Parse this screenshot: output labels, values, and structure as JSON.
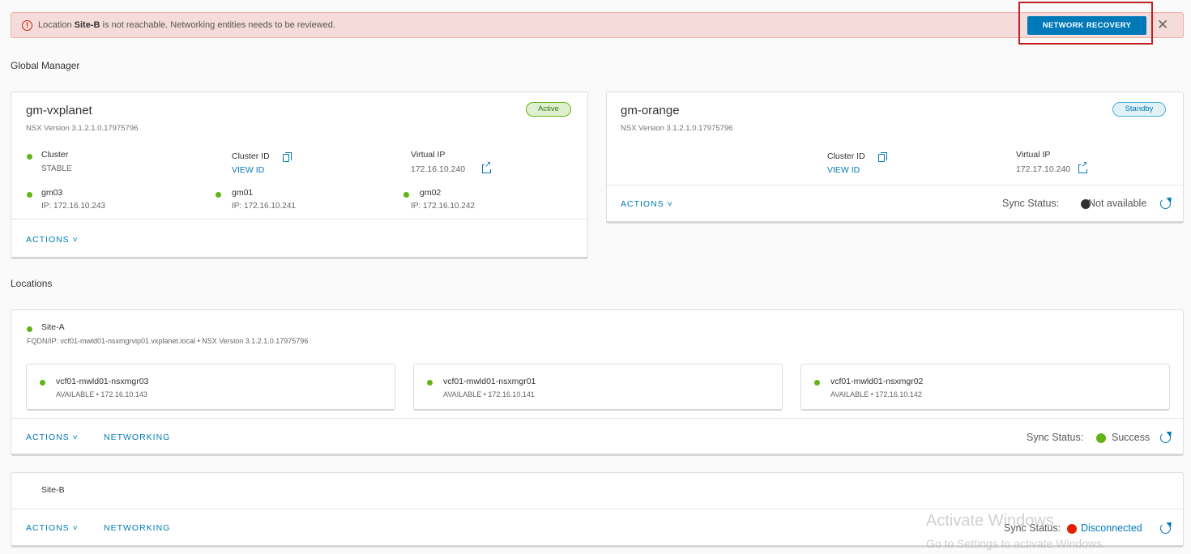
{
  "alert": {
    "prefix": "Location ",
    "site": "Site-B",
    "suffix": " is not reachable. Networking entities needs to be reviewed.",
    "button": "NETWORK RECOVERY",
    "close": "✕"
  },
  "global_manager": {
    "title": "Global Manager",
    "primary": {
      "name": "gm-vxplanet",
      "status": "Active",
      "version": "NSX Version  3.1.2.1.0.17975796",
      "cluster_label": "Cluster",
      "cluster_value": "STABLE",
      "cluster_id_label": "Cluster ID",
      "cluster_id_link": "VIEW ID",
      "vip_label": "Virtual IP",
      "vip_value": "172.16.10.240",
      "nodes": [
        {
          "name": "gm03",
          "ip": "IP: 172.16.10.243"
        },
        {
          "name": "gm01",
          "ip": "IP: 172.16.10.241"
        },
        {
          "name": "gm02",
          "ip": "IP: 172.16.10.242"
        }
      ],
      "actions": "ACTIONS ˅"
    },
    "standby": {
      "name": "gm-orange",
      "status": "Standby",
      "version": "NSX Version  3.1.2.1.0.17975796",
      "cluster_id_label": "Cluster ID",
      "cluster_id_link": "VIEW ID",
      "vip_label": "Virtual IP",
      "vip_value": "172.17.10.240",
      "actions": "ACTIONS ˅",
      "sync_label": "Sync Status:",
      "sync_value": "Not available",
      "sync_color": "#313131"
    }
  },
  "locations": {
    "title": "Locations",
    "site_a": {
      "name": "Site-A",
      "fqdn": "FQDN/IP: vcf01-mwld01-nsxmgrvip01.vxplanet.local • NSX Version 3.1.2.1.0.17975796",
      "managers": [
        {
          "name": "vcf01-mwld01-nsxmgr03",
          "detail": "AVAILABLE • 172.16.10.143"
        },
        {
          "name": "vcf01-mwld01-nsxmgr01",
          "detail": "AVAILABLE • 172.16.10.141"
        },
        {
          "name": "vcf01-mwld01-nsxmgr02",
          "detail": "AVAILABLE • 172.16.10.142"
        }
      ],
      "actions": "ACTIONS ˅",
      "networking": "NETWORKING",
      "sync_label": "Sync Status:",
      "sync_value": "Success",
      "sync_color": "#60b515"
    },
    "site_b": {
      "name": "Site-B",
      "actions": "ACTIONS ˅",
      "networking": "NETWORKING",
      "sync_label": "Sync Status:",
      "sync_value": "Disconnected",
      "sync_color": "#e12200"
    }
  },
  "watermark": {
    "line1": "Activate Windows",
    "line2": "Go to Settings to activate Windows."
  },
  "colors": {
    "accent": "#0079b8",
    "success": "#60b515",
    "danger": "#c92100"
  }
}
